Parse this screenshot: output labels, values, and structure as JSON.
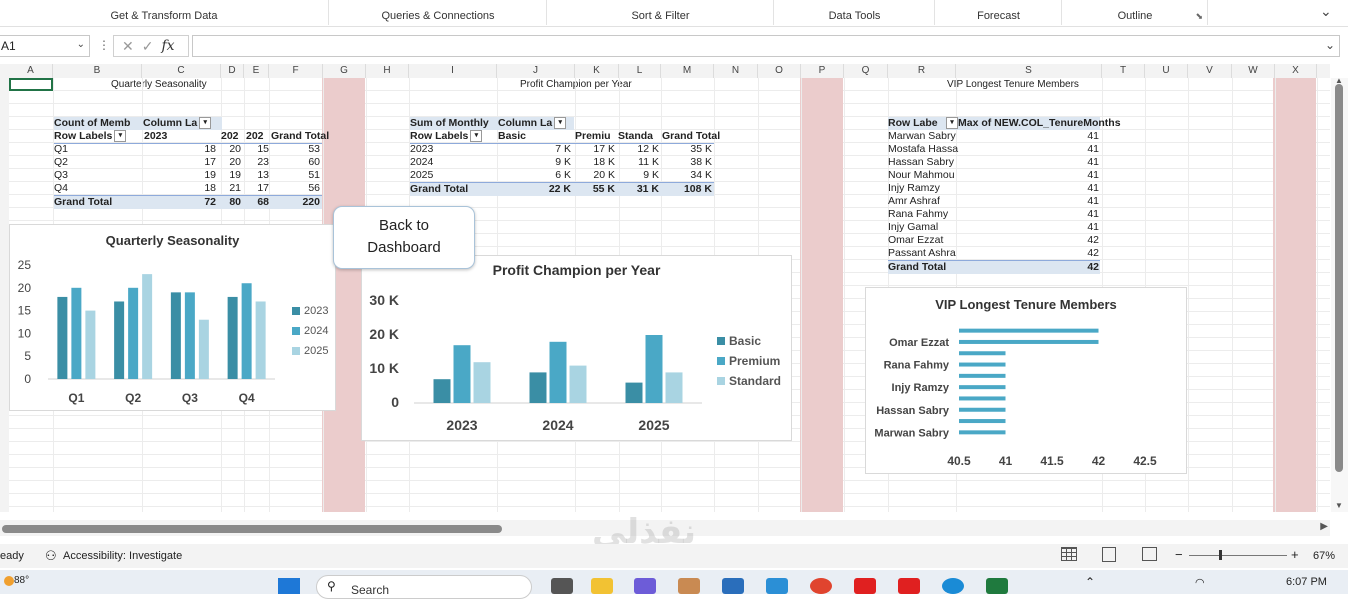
{
  "ribbon": {
    "groups": [
      "Get & Transform Data",
      "Queries & Connections",
      "Sort & Filter",
      "Data Tools",
      "Forecast",
      "Outline"
    ]
  },
  "formula_bar": {
    "name_box": "A1",
    "fx_label": "fx",
    "value": ""
  },
  "columns": [
    "A",
    "B",
    "C",
    "D",
    "E",
    "F",
    "G",
    "H",
    "I",
    "J",
    "K",
    "L",
    "M",
    "N",
    "O",
    "P",
    "Q",
    "R",
    "S",
    "T",
    "U",
    "V",
    "W",
    "X"
  ],
  "sheet_titles": {
    "quarterly": "Quarterly Seasonality",
    "profit": "Profit Champion per Year",
    "vip": "VIP Longest Tenure Members"
  },
  "pivot1": {
    "header1": "Count of Memb",
    "header2": "Column La",
    "row_labels": "Row Labels",
    "years": [
      "2023",
      "202",
      "202"
    ],
    "grand_total_label": "Grand Total",
    "rows": [
      {
        "label": "Q1",
        "v": [
          "18",
          "20",
          "15",
          "53"
        ]
      },
      {
        "label": "Q2",
        "v": [
          "17",
          "20",
          "23",
          "60"
        ]
      },
      {
        "label": "Q3",
        "v": [
          "19",
          "19",
          "13",
          "51"
        ]
      },
      {
        "label": "Q4",
        "v": [
          "18",
          "21",
          "17",
          "56"
        ]
      }
    ],
    "total": {
      "label": "Grand Total",
      "v": [
        "72",
        "80",
        "68",
        "220"
      ]
    }
  },
  "pivot2": {
    "header1": "Sum of Monthly",
    "header2": "Column La",
    "row_labels": "Row Labels",
    "cols": [
      "Basic",
      "Premiu",
      "Standa",
      "Grand Total"
    ],
    "rows": [
      {
        "label": "2023",
        "v": [
          "7 K",
          "17 K",
          "12 K",
          "35 K"
        ]
      },
      {
        "label": "2024",
        "v": [
          "9 K",
          "18 K",
          "11 K",
          "38 K"
        ]
      },
      {
        "label": "2025",
        "v": [
          "6 K",
          "20 K",
          "9 K",
          "34 K"
        ]
      }
    ],
    "total": {
      "label": "Grand Total",
      "v": [
        "22 K",
        "55 K",
        "31 K",
        "108 K"
      ]
    }
  },
  "pivot3": {
    "header1": "Row Labe",
    "header2": "Max of NEW.COL_TenureMonths",
    "rows": [
      {
        "label": "Marwan Sabry",
        "v": "41"
      },
      {
        "label": "Mostafa Hassa",
        "v": "41"
      },
      {
        "label": "Hassan Sabry",
        "v": "41"
      },
      {
        "label": "Nour Mahmou",
        "v": "41"
      },
      {
        "label": "Injy Ramzy",
        "v": "41"
      },
      {
        "label": "Amr Ashraf",
        "v": "41"
      },
      {
        "label": "Rana Fahmy",
        "v": "41"
      },
      {
        "label": "Injy Gamal",
        "v": "41"
      },
      {
        "label": "Omar Ezzat",
        "v": "42"
      },
      {
        "label": "Passant Ashra",
        "v": "42"
      }
    ],
    "total": {
      "label": "Grand Total",
      "v": "42"
    }
  },
  "back_button": {
    "line1": "Back to",
    "line2": "Dashboard"
  },
  "chart_data": [
    {
      "type": "bar",
      "title": "Quarterly Seasonality",
      "categories": [
        "Q1",
        "Q2",
        "Q3",
        "Q4"
      ],
      "series": [
        {
          "name": "2023",
          "values": [
            18,
            17,
            19,
            18
          ],
          "color": "#3a8ea5"
        },
        {
          "name": "2024",
          "values": [
            20,
            20,
            19,
            21
          ],
          "color": "#4aa8c6"
        },
        {
          "name": "2025",
          "values": [
            15,
            23,
            13,
            17
          ],
          "color": "#a9d4e2"
        }
      ],
      "ylim": [
        0,
        25
      ],
      "yticks": [
        "0",
        "5",
        "10",
        "15",
        "20",
        "25"
      ]
    },
    {
      "type": "bar",
      "title": "Profit Champion per Year",
      "categories": [
        "2023",
        "2024",
        "2025"
      ],
      "series": [
        {
          "name": "Basic",
          "values": [
            7,
            9,
            6
          ],
          "color": "#3a8ea5"
        },
        {
          "name": "Premium",
          "values": [
            17,
            18,
            20
          ],
          "color": "#4aa8c6"
        },
        {
          "name": "Standard",
          "values": [
            12,
            11,
            9
          ],
          "color": "#a9d4e2"
        }
      ],
      "ylim": [
        0,
        30
      ],
      "yticks": [
        "0",
        "10 K",
        "20 K",
        "30 K"
      ]
    },
    {
      "type": "bar",
      "orientation": "horizontal",
      "title": "VIP Longest Tenure Members",
      "categories": [
        "Marwan Sabry",
        "Mostafa Hassan",
        "Hassan Sabry",
        "Nour Mahmoud",
        "Injy Ramzy",
        "Amr Ashraf",
        "Rana Fahmy",
        "Injy Gamal",
        "Omar Ezzat",
        "Passant Ashraf"
      ],
      "visible_labels": [
        "Omar Ezzat",
        "Rana Fahmy",
        "Injy Ramzy",
        "Hassan Sabry",
        "Marwan Sabry"
      ],
      "values": [
        41,
        41,
        41,
        41,
        41,
        41,
        41,
        41,
        42,
        42
      ],
      "xlim": [
        40.5,
        42.5
      ],
      "xticks": [
        "40.5",
        "41",
        "41.5",
        "42",
        "42.5"
      ],
      "color": "#4aa8c6"
    }
  ],
  "status": {
    "ready": "eady",
    "accessibility": "Accessibility: Investigate",
    "zoom": "67%"
  },
  "taskbar": {
    "weather": "88°",
    "search": "Search",
    "time": "6:07 PM"
  },
  "watermark": "نفذلي"
}
